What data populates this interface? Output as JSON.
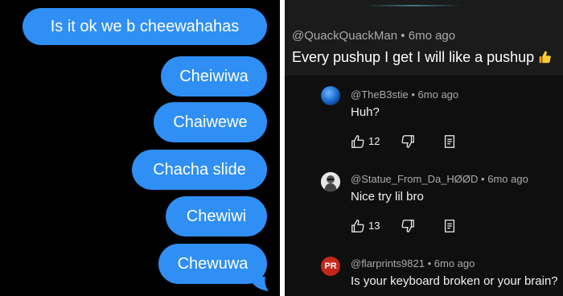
{
  "chat": {
    "messages": [
      "Is it ok we b cheewahahas",
      "Cheiwiwa",
      "Chaiwewe",
      "Chacha slide",
      "Chewiwi",
      "Chewuwa"
    ],
    "bubble_color": "#2f8ff5"
  },
  "comments": {
    "top": {
      "author": "@QuackQuackMan",
      "time": "6mo ago",
      "text": "Every pushup I get I will like a pushup",
      "emoji": "thumbs-up-emoji"
    },
    "replies": [
      {
        "author": "@TheB3stie",
        "time": "6mo ago",
        "text": "Huh?",
        "likes": "12",
        "avatar": "blue-orb-avatar"
      },
      {
        "author": "@Statue_From_Da_HØØD",
        "time": "6mo ago",
        "text": "Nice try lil bro",
        "likes": "13",
        "avatar": "statue-avatar"
      },
      {
        "author": "@flarprints9821",
        "time": "6mo ago",
        "text": "Is your keyboard broken or your brain?",
        "avatar_initials": "PR"
      }
    ]
  }
}
